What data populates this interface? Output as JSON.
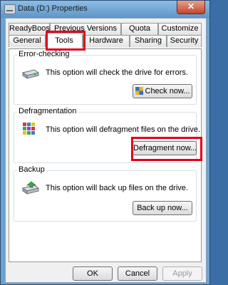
{
  "window": {
    "title": "Data (D:) Properties",
    "close_label": "✕"
  },
  "tabs_row_top": [
    {
      "label": "ReadyBoost"
    },
    {
      "label": "Previous Versions"
    },
    {
      "label": "Quota"
    },
    {
      "label": "Customize"
    }
  ],
  "tabs_row_bottom": [
    {
      "label": "General"
    },
    {
      "label": "Tools"
    },
    {
      "label": "Hardware"
    },
    {
      "label": "Sharing"
    },
    {
      "label": "Security"
    }
  ],
  "sections": {
    "error_checking": {
      "title": "Error-checking",
      "text": "This option will check the drive for errors.",
      "button": "Check now..."
    },
    "defragmentation": {
      "title": "Defragmentation",
      "text": "This option will defragment files on the drive.",
      "button": "Defragment now..."
    },
    "backup": {
      "title": "Backup",
      "text": "This option will back up files on the drive.",
      "button": "Back up now..."
    }
  },
  "footer": {
    "ok": "OK",
    "cancel": "Cancel",
    "apply": "Apply"
  },
  "colors": {
    "highlight": "#e3001b",
    "title_bar": "#6ea2cf"
  }
}
